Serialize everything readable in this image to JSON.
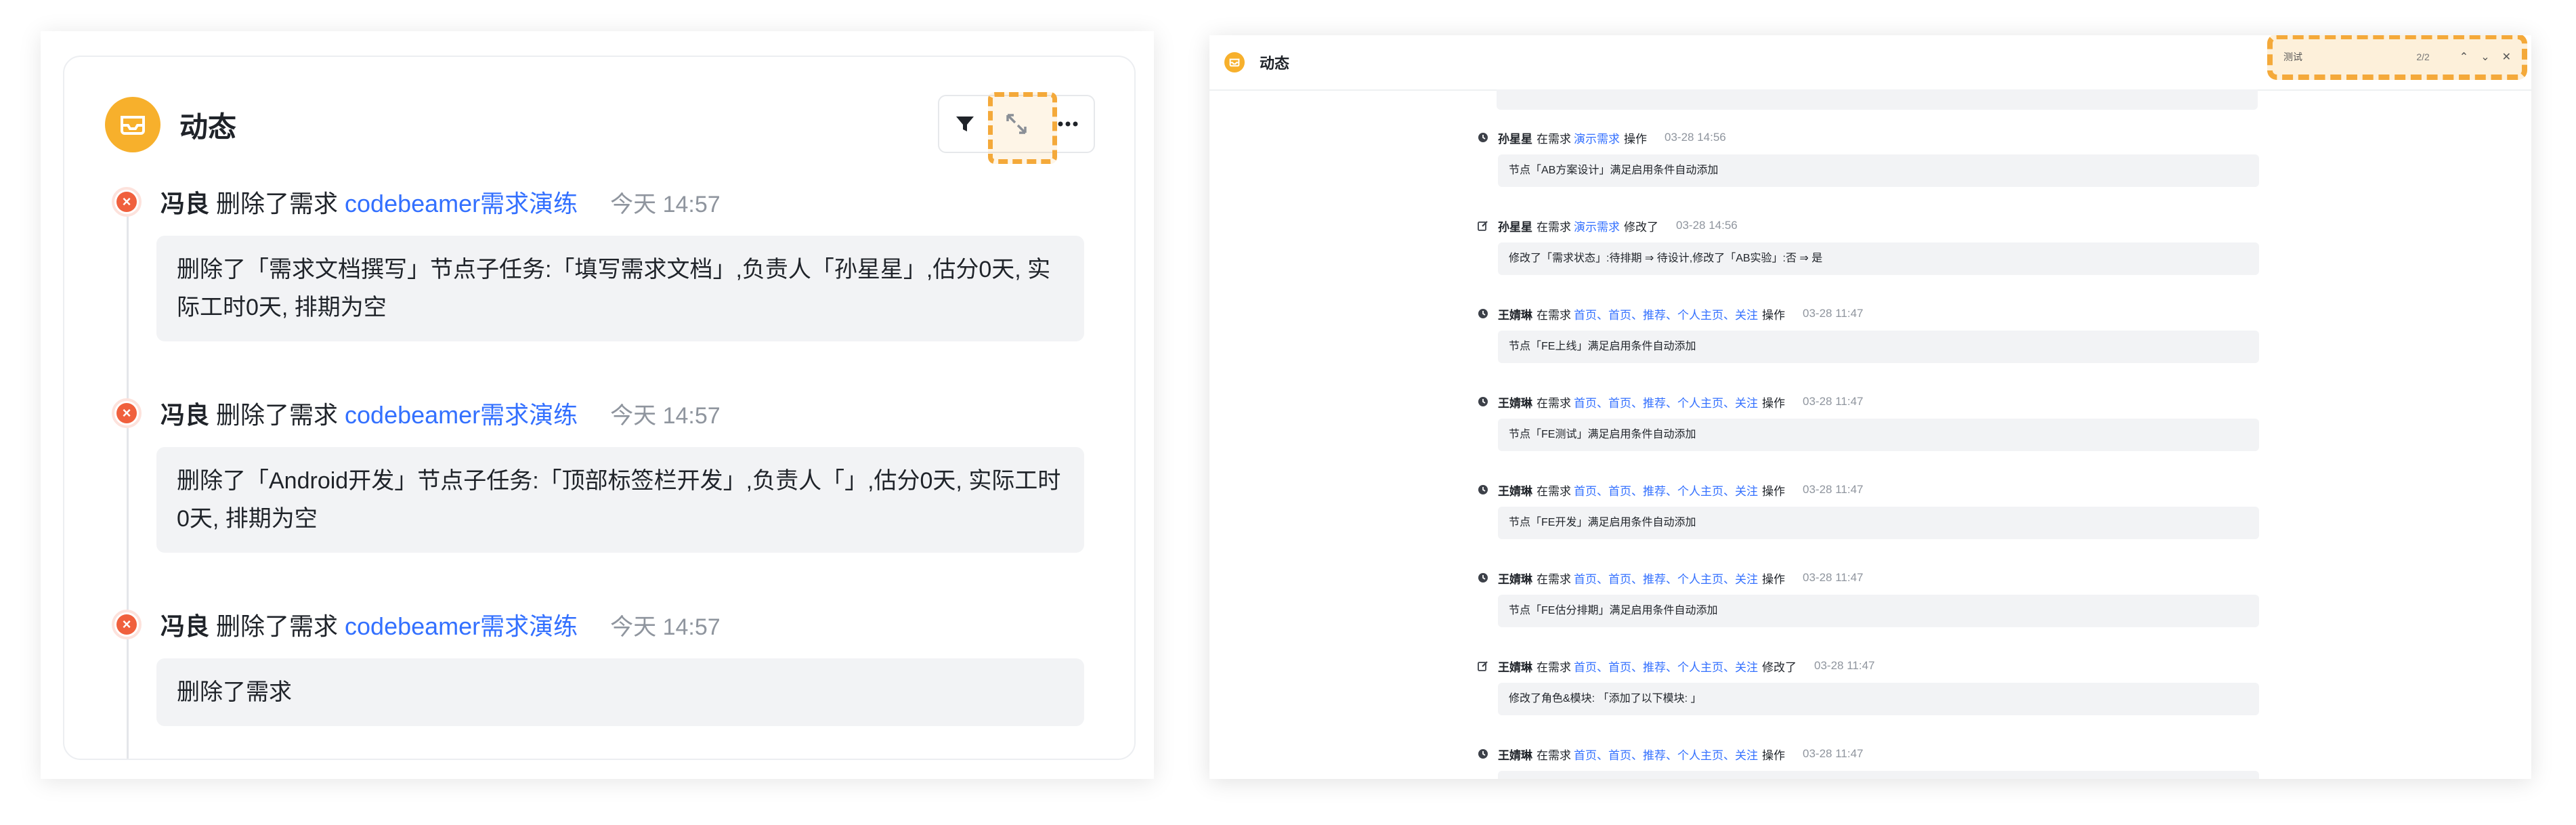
{
  "left": {
    "title": "动态",
    "toolbar": {
      "filter_icon": "filter-icon",
      "expand_icon": "expand-icon",
      "more_icon": "more-icon"
    },
    "entries": [
      {
        "user": "冯良",
        "action": "删除了需求",
        "link": "codebeamer需求演练",
        "time": "今天 14:57",
        "detail": "删除了「需求文档撰写」节点子任务:「填写需求文档」,负责人「孙星星」,估分0天, 实际工时0天, 排期为空"
      },
      {
        "user": "冯良",
        "action": "删除了需求",
        "link": "codebeamer需求演练",
        "time": "今天 14:57",
        "detail": "删除了「Android开发」节点子任务:「顶部标签栏开发」,负责人「」,估分0天, 实际工时0天, 排期为空"
      },
      {
        "user": "冯良",
        "action": "删除了需求",
        "link": "codebeamer需求演练",
        "time": "今天 14:57",
        "detail": "删除了需求"
      }
    ]
  },
  "right": {
    "title": "动态",
    "find_bar": {
      "query": "测试",
      "count": "2/2"
    },
    "entries": [
      {
        "user": "孙星星",
        "pre": "在需求",
        "link": "演示需求",
        "post": "操作",
        "time": "03-28 14:56",
        "detail": "节点「AB方案设计」满足启用条件自动添加",
        "icon": "clock-icon"
      },
      {
        "user": "孙星星",
        "pre": "在需求",
        "link": "演示需求",
        "post": "修改了",
        "time": "03-28 14:56",
        "detail": "修改了「需求状态」:待排期 ⇒ 待设计,修改了「AB实验」:否 ⇒ 是",
        "icon": "edit-icon"
      },
      {
        "user": "王婧琳",
        "pre": "在需求",
        "link": "首页、首页、推荐、个人主页、关注",
        "post": "操作",
        "time": "03-28 11:47",
        "detail": "节点「FE上线」满足启用条件自动添加",
        "icon": "clock-icon"
      },
      {
        "user": "王婧琳",
        "pre": "在需求",
        "link": "首页、首页、推荐、个人主页、关注",
        "post": "操作",
        "time": "03-28 11:47",
        "detail": "节点「FE测试」满足启用条件自动添加",
        "icon": "clock-icon"
      },
      {
        "user": "王婧琳",
        "pre": "在需求",
        "link": "首页、首页、推荐、个人主页、关注",
        "post": "操作",
        "time": "03-28 11:47",
        "detail": "节点「FE开发」满足启用条件自动添加",
        "icon": "clock-icon"
      },
      {
        "user": "王婧琳",
        "pre": "在需求",
        "link": "首页、首页、推荐、个人主页、关注",
        "post": "操作",
        "time": "03-28 11:47",
        "detail": "节点「FE估分排期」满足启用条件自动添加",
        "icon": "clock-icon"
      },
      {
        "user": "王婧琳",
        "pre": "在需求",
        "link": "首页、首页、推荐、个人主页、关注",
        "post": "修改了",
        "time": "03-28 11:47",
        "detail": "修改了角色&模块: 「添加了以下模块: 」",
        "icon": "edit-icon"
      },
      {
        "user": "王婧琳",
        "pre": "在需求",
        "link": "首页、首页、推荐、个人主页、关注",
        "post": "操作",
        "time": "03-28 11:47",
        "detail": "",
        "icon": "clock-icon"
      }
    ]
  },
  "colors": {
    "accent": "#f7b02c",
    "link": "#3370ff",
    "highlight": "#f4a93a",
    "delete": "#f0603d"
  }
}
